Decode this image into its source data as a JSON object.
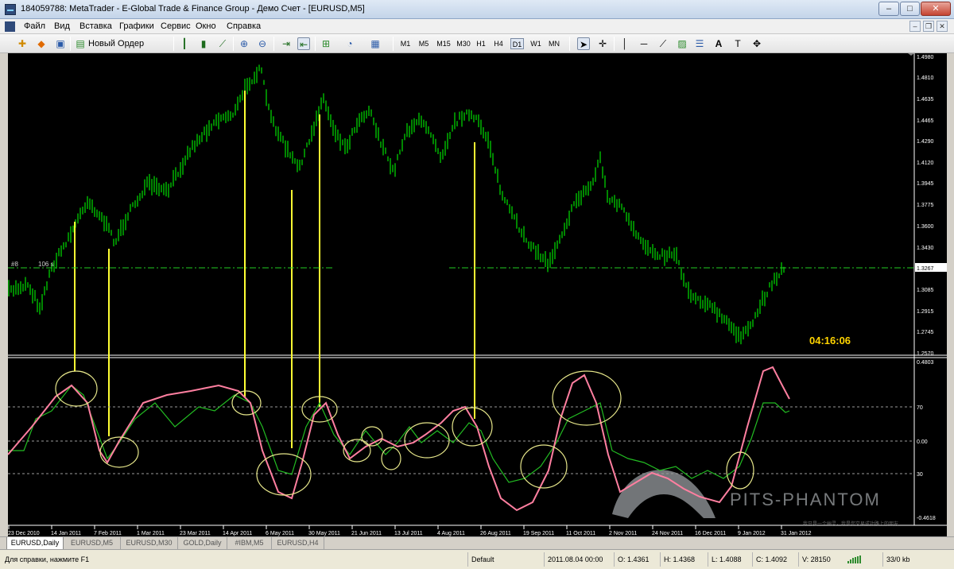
{
  "window": {
    "title": "184059788: MetaTrader - E-Global Trade & Finance Group - Демо Счет - [EURUSD,M5]",
    "minimize_label": "–",
    "maximize_label": "□",
    "close_label": "✕"
  },
  "menu": {
    "items": [
      "Файл",
      "Вид",
      "Вставка",
      "Графики",
      "Сервис",
      "Окно",
      "Справка"
    ]
  },
  "toolbar": {
    "new_order_label": "Новый Ордер",
    "timeframes": [
      "M1",
      "M5",
      "M15",
      "M30",
      "H1",
      "H4",
      "D1",
      "W1",
      "MN"
    ],
    "active_timeframe": "D1"
  },
  "chart": {
    "price_scale": [
      "1.4980",
      "1.4810",
      "1.4635",
      "1.4465",
      "1.4290",
      "1.4120",
      "1.3945",
      "1.3775",
      "1.3600",
      "1.3430",
      "1.3085",
      "1.2915",
      "1.2745",
      "1.2570"
    ],
    "current_price": "1.3267",
    "order_line_label": "#8",
    "order_line_label_rest": "106 s",
    "countdown": "04:16:06",
    "indicator_scale": [
      "0.4803",
      "70",
      "0.00",
      "30",
      "-0.4618"
    ],
    "date_axis": [
      "23 Dec 2010",
      "14 Jan 2011",
      "7 Feb 2011",
      "1 Mar 2011",
      "23 Mar 2011",
      "14 Apr 2011",
      "6 May 2011",
      "30 May 2011",
      "21 Jun 2011",
      "13 Jul 2011",
      "4 Aug 2011",
      "26 Aug 2011",
      "19 Sep 2011",
      "11 Oct 2011",
      "2 Nov 2011",
      "24 Nov 2011",
      "16 Dec 2011",
      "9 Jan 2012",
      "31 Jan 2012"
    ],
    "watermark": "PITS-PHANTOM",
    "watermark_sub": "我只是一个幽灵，我是您交易成功路上的朋友",
    "colors": {
      "background": "#000000",
      "bull_bar": "#00e000",
      "vertical_marker": "#ffff33",
      "oscillator_fast": "#ff7fa0",
      "oscillator_slow": "#22bb22",
      "ellipse": "#e6e68a",
      "order_line": "#22cc22",
      "countdown": "#ffd400"
    }
  },
  "tabs": {
    "items": [
      "EURUSD,Daily",
      "EURUSD,M5",
      "EURUSD,M30",
      "GOLD,Daily",
      "#IBM,M5",
      "EURUSD,H4"
    ],
    "active": "EURUSD,Daily"
  },
  "status": {
    "help": "Для справки, нажмите F1",
    "profile": "Default",
    "datetime": "2011.08.04 00:00",
    "open": "O: 1.4361",
    "high": "H: 1.4368",
    "low": "L: 1.4088",
    "close": "C: 1.4092",
    "volume": "V: 28150",
    "traffic": "33/0 kb"
  }
}
